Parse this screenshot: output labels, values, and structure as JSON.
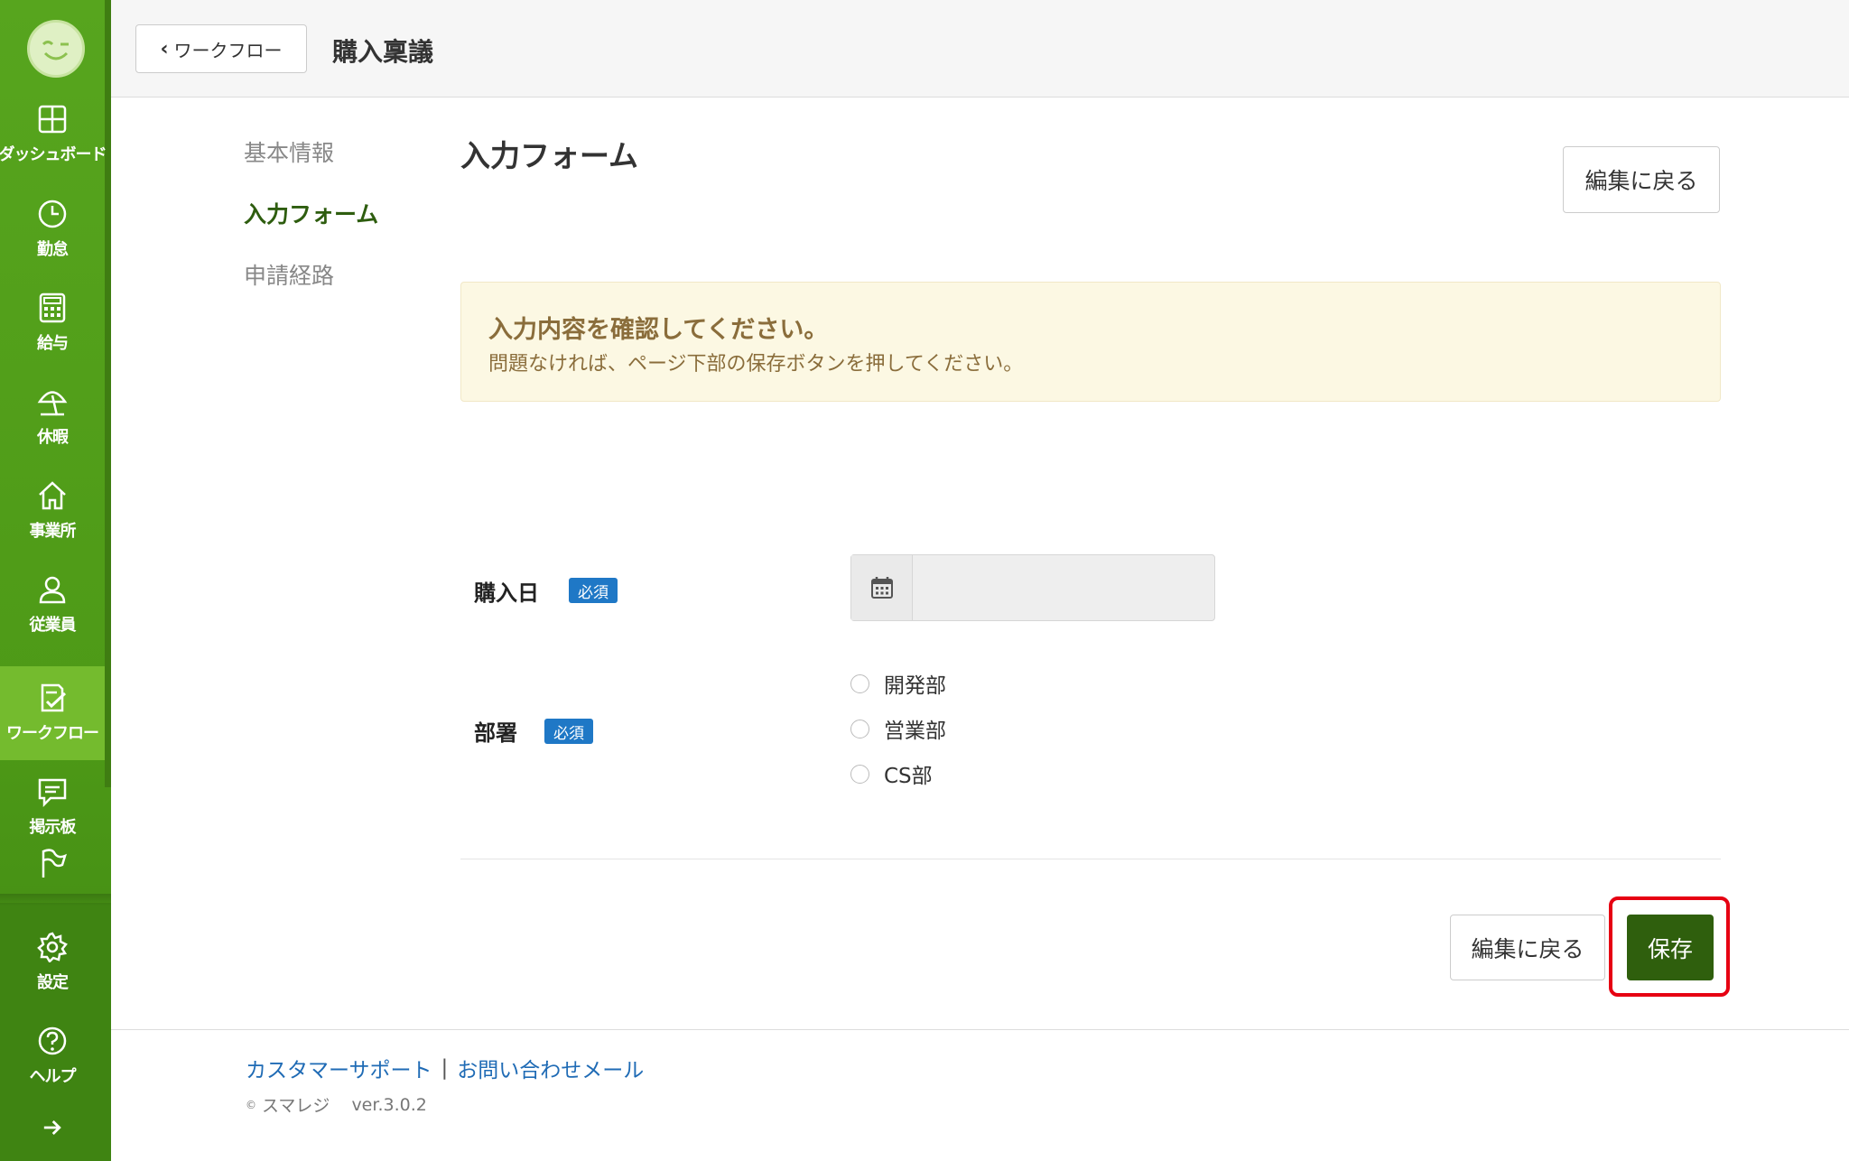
{
  "header": {
    "back_label": "ワークフロー",
    "title": "購入稟議"
  },
  "sidebar": {
    "items": [
      {
        "label": "ダッシュボード",
        "icon": "dashboard-icon"
      },
      {
        "label": "勤怠",
        "icon": "clock-icon"
      },
      {
        "label": "給与",
        "icon": "calculator-icon"
      },
      {
        "label": "休暇",
        "icon": "parasol-icon"
      },
      {
        "label": "事業所",
        "icon": "home-icon"
      },
      {
        "label": "従業員",
        "icon": "user-icon"
      },
      {
        "label": "ワークフロー",
        "icon": "workflow-icon",
        "active": true
      },
      {
        "label": "掲示板",
        "icon": "chat-icon"
      },
      {
        "label": "",
        "icon": "flag-icon"
      },
      {
        "label": "設定",
        "icon": "gear-icon"
      },
      {
        "label": "ヘルプ",
        "icon": "help-icon"
      }
    ]
  },
  "steps": [
    "基本情報",
    "入力フォーム",
    "申請経路"
  ],
  "main": {
    "section_title": "入力フォーム",
    "top_back_label": "編集に戻る",
    "alert": {
      "title": "入力内容を確認してください。",
      "body": "問題なければ、ページ下部の保存ボタンを押してください。"
    },
    "fields": {
      "purchase_date": {
        "label": "購入日",
        "required": "必須",
        "value": ""
      },
      "department": {
        "label": "部署",
        "required": "必須",
        "options": [
          "開発部",
          "営業部",
          "CS部"
        ]
      }
    },
    "bottom_back_label": "編集に戻る",
    "save_label": "保存"
  },
  "footer": {
    "support_link": "カスタマーサポート",
    "separator": "|",
    "contact_link": "お問い合わせメール",
    "copyright_symbol": "©",
    "brand": "スマレジ",
    "version": "ver.3.0.2"
  },
  "colors": {
    "sidebar": "#4e9a17",
    "active_nav": "#74bb2e",
    "save_button": "#2f5f0d",
    "badge": "#1f78c6",
    "highlight": "#e60012",
    "alert_bg": "#fcf8e3"
  }
}
